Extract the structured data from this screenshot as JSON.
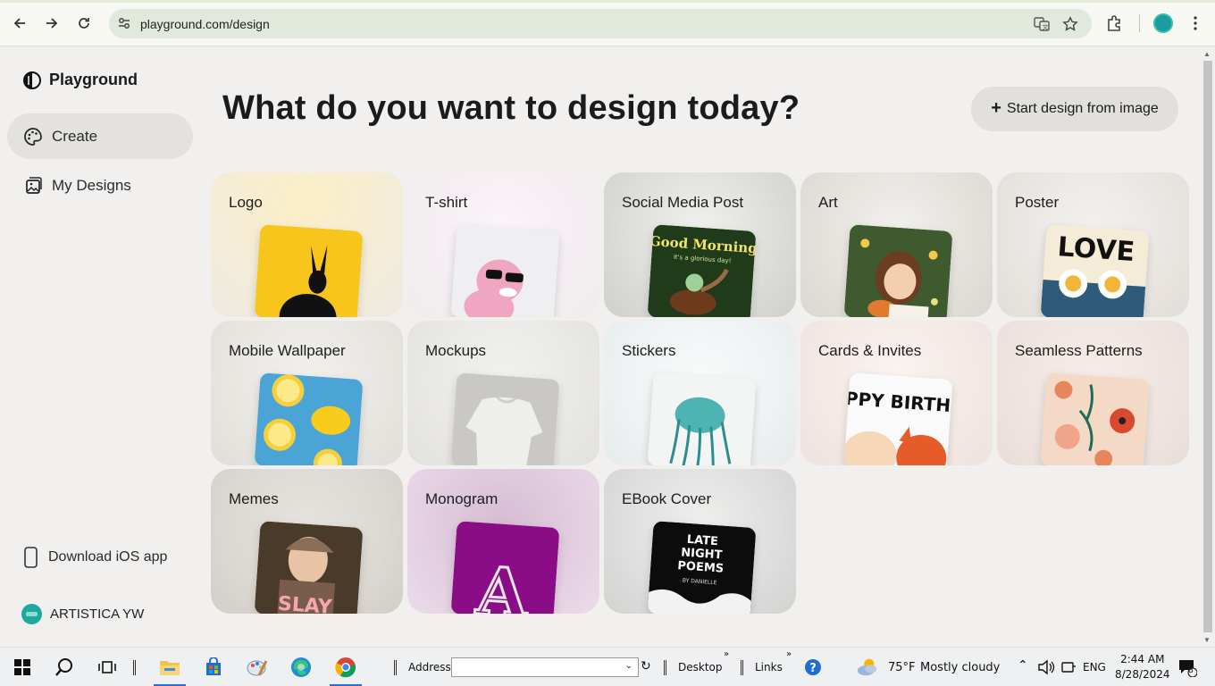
{
  "browser": {
    "url": "playground.com/design"
  },
  "sidebar": {
    "brand": "Playground",
    "items": [
      {
        "label": "Create",
        "icon": "palette-icon",
        "active": true
      },
      {
        "label": "My Designs",
        "icon": "gallery-icon",
        "active": false
      }
    ],
    "download_label": "Download iOS app",
    "user_name": "ARTISTICA YW"
  },
  "main": {
    "headline": "What do you want to design today?",
    "start_button": "Start design from image",
    "cards": [
      {
        "title": "Logo",
        "thumb_text": ""
      },
      {
        "title": "T-shirt",
        "thumb_text": ""
      },
      {
        "title": "Social Media Post",
        "thumb_text": "Good Morning",
        "thumb_sub": "it's a glorious day!"
      },
      {
        "title": "Art",
        "thumb_text": ""
      },
      {
        "title": "Poster",
        "thumb_text": "LOVE"
      },
      {
        "title": "Mobile Wallpaper",
        "thumb_text": ""
      },
      {
        "title": "Mockups",
        "thumb_text": ""
      },
      {
        "title": "Stickers",
        "thumb_text": ""
      },
      {
        "title": "Cards & Invites",
        "thumb_text": "APPY BIRTHD"
      },
      {
        "title": "Seamless Patterns",
        "thumb_text": ""
      },
      {
        "title": "Memes",
        "thumb_text": "SLAY"
      },
      {
        "title": "Monogram",
        "thumb_text": "A"
      },
      {
        "title": "EBook Cover",
        "thumb_text": "LATE NIGHT POEMS",
        "thumb_sub": "BY DANIELLE"
      }
    ]
  },
  "taskbar": {
    "address_label": "Address",
    "desktop_label": "Desktop",
    "links_label": "Links",
    "weather_temp": "75°F",
    "weather_text": "Mostly cloudy",
    "language": "ENG",
    "time": "2:44 AM",
    "date": "8/28/2024",
    "notification_count": "8"
  },
  "colors": {
    "accent_teal": "#1ea8a0",
    "active_taskbar": "#2a6fd6"
  }
}
